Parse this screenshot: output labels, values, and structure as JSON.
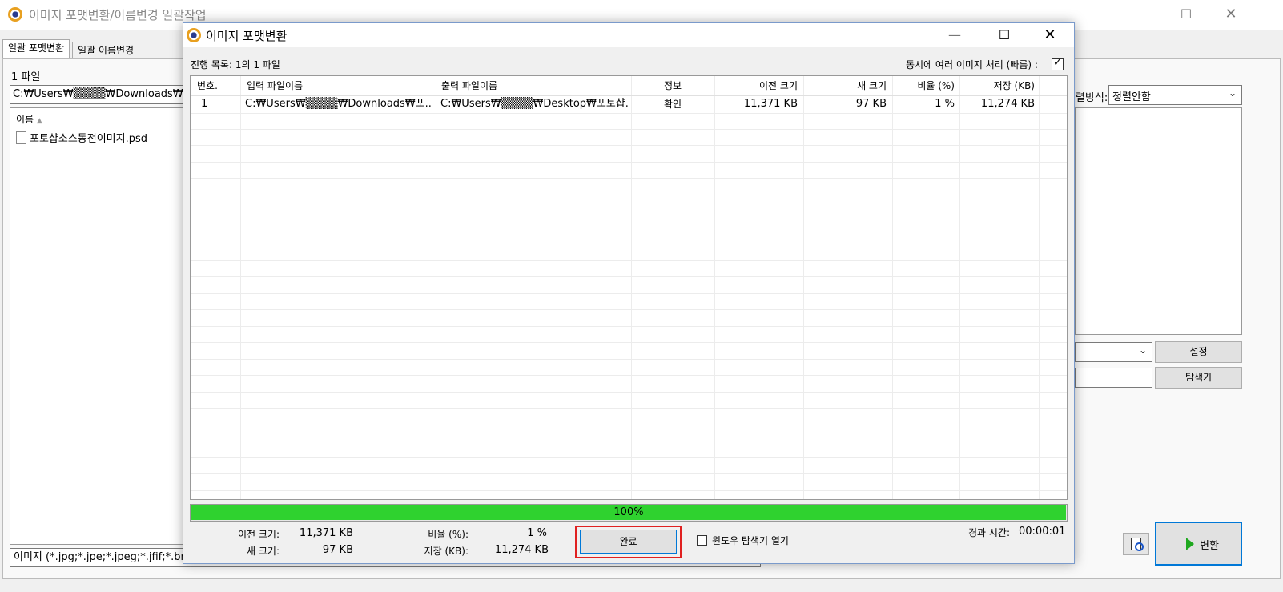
{
  "main": {
    "title": "이미지 포맷변환/이름변경 일괄작업",
    "tabs": [
      "일괄 포맷변환",
      "일괄 이름변경"
    ],
    "file_count": "1 파일",
    "path_value": "C:₩Users₩▒▒▒▒₩Downloads₩포토",
    "list_header": "이름",
    "files": [
      "포토샵소스동전이미지.psd"
    ],
    "sort_label": "렬방식:",
    "sort_value": "정렬안함",
    "settings_button": "설정",
    "browse_button": "탐색기",
    "filter_text": "이미지 (*.jpg;*.jpe;*.jpeg;*.jfif;*.bmp;",
    "convert_button": "변환"
  },
  "dialog": {
    "title": "이미지 포맷변환",
    "progress_label": "진행 목록: 1의 1 파일",
    "parallel_label": "동시에 여러 이미지 처리 (빠름) :",
    "parallel_checked": true,
    "columns": [
      "번호.",
      "입력 파일이름",
      "출력 파일이름",
      "정보",
      "이전 크기",
      "새 크기",
      "비율 (%)",
      "저장 (KB)"
    ],
    "rows": [
      {
        "num": "1",
        "input": "C:₩Users₩▒▒▒▒₩Downloads₩포...",
        "output": "C:₩Users₩▒▒▒▒₩Desktop₩포토샵...",
        "info": "확인",
        "old": "11,371 KB",
        "new": "97 KB",
        "ratio": "1 %",
        "saved": "11,274 KB"
      }
    ],
    "progress_percent": 100,
    "progress_text": "100%",
    "summary": {
      "old_label": "이전 크기:",
      "old_value": "11,371 KB",
      "new_label": "새 크기:",
      "new_value": "97 KB",
      "ratio_label": "비율 (%):",
      "ratio_value": "1 %",
      "saved_label": "저장 (KB):",
      "saved_value": "11,274 KB"
    },
    "done_button": "완료",
    "open_explorer_label": "윈도우 탐색기 열기",
    "elapsed_label": "경과 시간:",
    "elapsed_value": "00:00:01"
  },
  "colors": {
    "progress": "#2fd22f",
    "highlight": "#e02020"
  }
}
